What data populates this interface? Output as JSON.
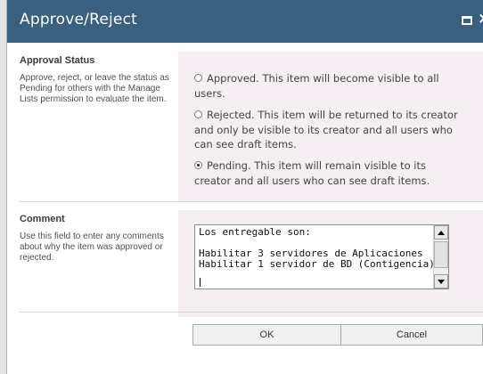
{
  "dialog": {
    "title": "Approve/Reject",
    "window_controls": {
      "maximize_icon": "maximize-icon",
      "close_icon": "close-icon",
      "close_glyph": "×"
    }
  },
  "approval_status": {
    "heading": "Approval Status",
    "description": "Approve, reject, or leave the status as Pending for others with the Manage Lists permission to evaluate the item.",
    "options": [
      {
        "label": "Approved. This item will become visible to all users.",
        "selected": false
      },
      {
        "label": "Rejected. This item will be returned to its creator and only be visible to its creator and all users who can see draft items.",
        "selected": false
      },
      {
        "label": "Pending. This item will remain visible to its creator and all users who can see draft items.",
        "selected": true
      }
    ]
  },
  "comment": {
    "heading": "Comment",
    "description": "Use this field to enter any comments about why the item was approved or rejected.",
    "value": "Los entregable son:\n\nHabilitar 3 servidores de Aplicaciones\nHabilitar 1 servidor de BD (Contigencia)"
  },
  "buttons": {
    "ok": "OK",
    "cancel": "Cancel"
  },
  "colors": {
    "titlebar": "#3a607f",
    "field_background": "#f5eff3"
  }
}
